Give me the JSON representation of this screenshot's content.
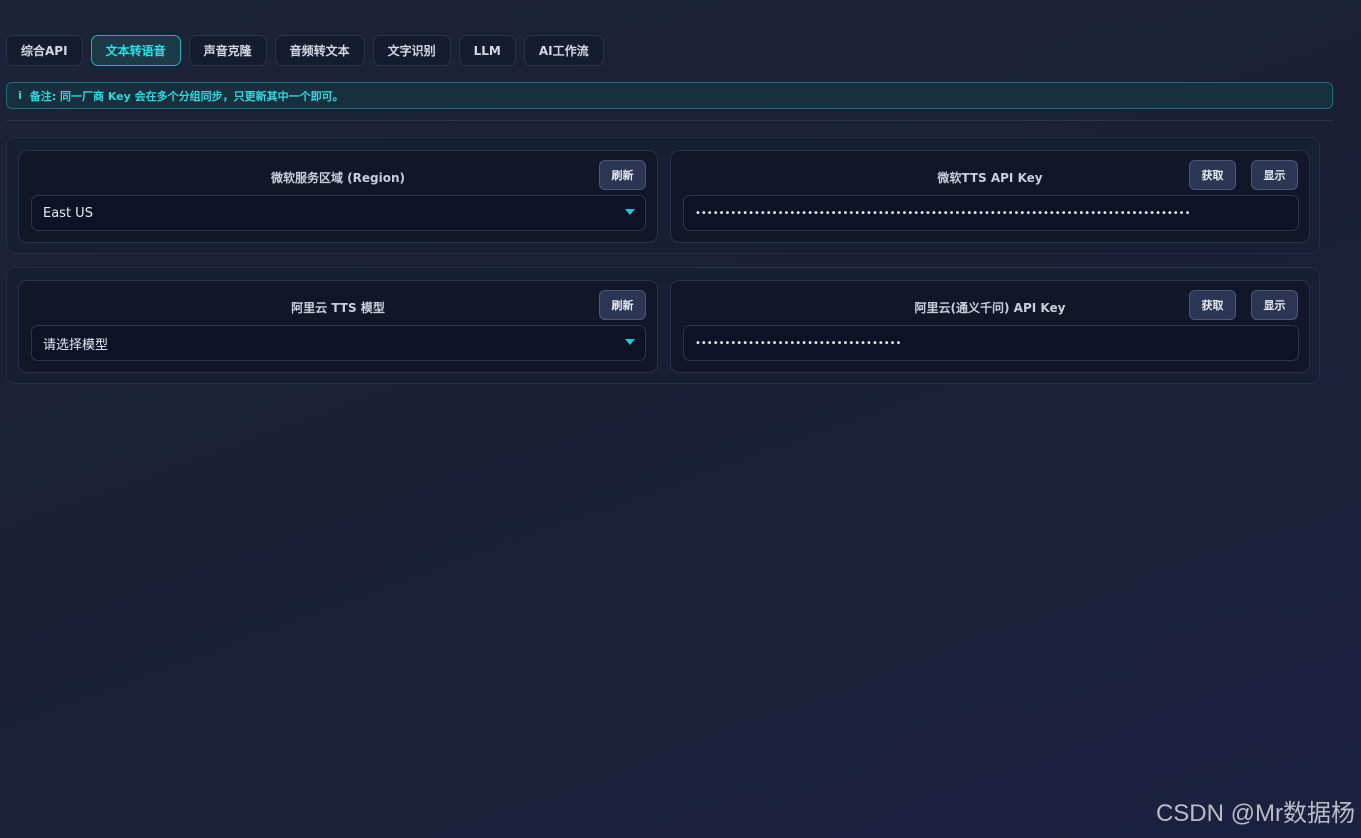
{
  "tabs": [
    {
      "label": "综合API",
      "active": false
    },
    {
      "label": "文本转语音",
      "active": true
    },
    {
      "label": "声音克隆",
      "active": false
    },
    {
      "label": "音频转文本",
      "active": false
    },
    {
      "label": "文字识别",
      "active": false
    },
    {
      "label": "LLM",
      "active": false
    },
    {
      "label": "AI工作流",
      "active": false
    }
  ],
  "notice": {
    "icon": "info-icon",
    "icon_glyph": "i",
    "text": "备注: 同一厂商 Key 会在多个分组同步，只更新其中一个即可。"
  },
  "groups": [
    {
      "left": {
        "label": "微软服务区域 (Region)",
        "refresh_label": "刷新",
        "select_value": "East US"
      },
      "right": {
        "label": "微软TTS API Key",
        "get_label": "获取",
        "show_label": "显示",
        "masked_value": "••••••••••••••••••••••••••••••••••••••••••••••••••••••••••••••••••••••••••••••••••••"
      }
    },
    {
      "left": {
        "label": "阿里云 TTS 模型",
        "refresh_label": "刷新",
        "select_value": "请选择模型"
      },
      "right": {
        "label": "阿里云(通义千问) API Key",
        "get_label": "获取",
        "show_label": "显示",
        "masked_value": "•••••••••••••••••••••••••••••••••••"
      }
    }
  ],
  "watermark": "CSDN @Mr数据杨",
  "colors": {
    "accent": "#2fe0e8",
    "background": "#1a1f36",
    "button": "#2b3654"
  }
}
